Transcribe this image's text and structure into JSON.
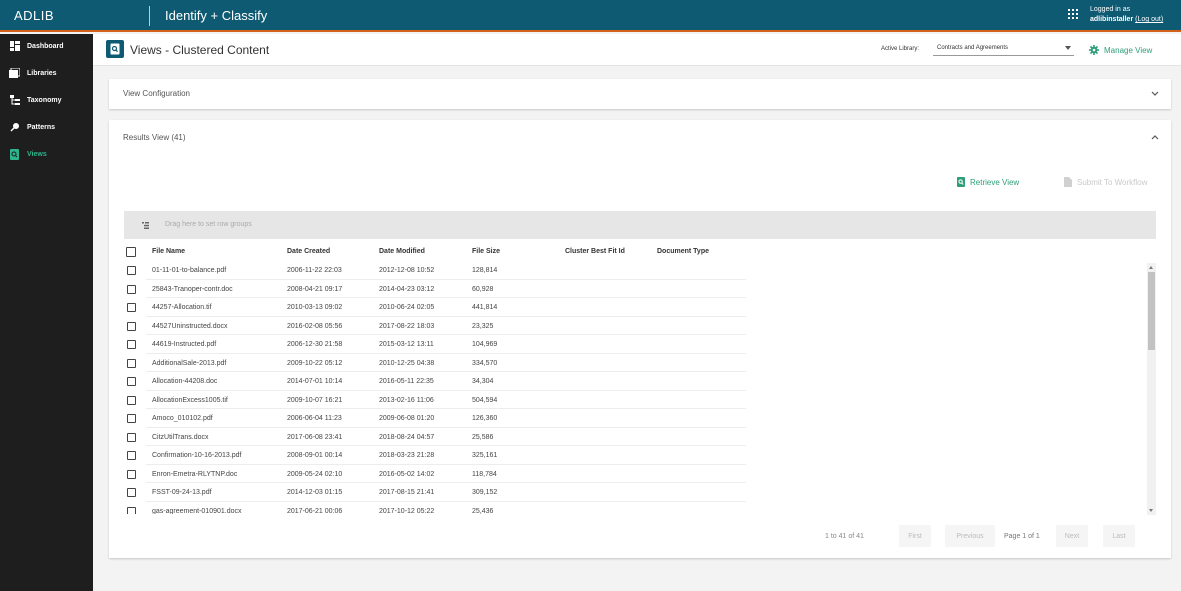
{
  "topbar": {
    "brand": "ADLIB",
    "app_title": "Identify + Classify",
    "logged_in_label": "Logged in as",
    "user": "adlibinstaller",
    "logout": "(Log out)"
  },
  "sidebar": {
    "items": [
      {
        "label": "Dashboard",
        "icon": "dashboard-icon"
      },
      {
        "label": "Libraries",
        "icon": "library-icon"
      },
      {
        "label": "Taxonomy",
        "icon": "taxonomy-icon"
      },
      {
        "label": "Patterns",
        "icon": "patterns-icon"
      },
      {
        "label": "Views",
        "icon": "views-icon",
        "active": true
      }
    ]
  },
  "header": {
    "title": "Views - Clustered Content",
    "active_library_label": "Active Library:",
    "active_library_value": "Contracts and Agreements",
    "manage_view": "Manage View"
  },
  "config_panel": {
    "title": "View Configuration"
  },
  "results": {
    "title": "Results View (41)",
    "retrieve_view": "Retrieve View",
    "submit_workflow": "Submit To Workflow",
    "group_placeholder": "Drag here to set row groups",
    "columns": [
      "File Name",
      "Date Created",
      "Date Modified",
      "File Size",
      "Cluster Best Fit Id",
      "Document Type"
    ],
    "rows": [
      [
        "01-11-01-to-balance.pdf",
        "2006-11-22 22:03",
        "2012-12-08 10:52",
        "128,814"
      ],
      [
        "25843-Tranoper-contr.doc",
        "2008-04-21 09:17",
        "2014-04-23 03:12",
        "60,928"
      ],
      [
        "44257-Allocation.tif",
        "2010-03-13 09:02",
        "2010-06-24 02:05",
        "441,814"
      ],
      [
        "44527Uninstructed.docx",
        "2016-02-08 05:56",
        "2017-08-22 18:03",
        "23,325"
      ],
      [
        "44619-Instructed.pdf",
        "2006-12-30 21:58",
        "2015-03-12 13:11",
        "104,969"
      ],
      [
        "AdditionalSale-2013.pdf",
        "2009-10-22 05:12",
        "2010-12-25 04:38",
        "334,570"
      ],
      [
        "Allocation-44208.doc",
        "2014-07-01 10:14",
        "2016-05-11 22:35",
        "34,304"
      ],
      [
        "AllocationExcess1005.tif",
        "2009-10-07 16:21",
        "2013-02-16 11:06",
        "504,594"
      ],
      [
        "Amoco_010102.pdf",
        "2006-06-04 11:23",
        "2009-06-08 01:20",
        "126,360"
      ],
      [
        "CitzUtilTrans.docx",
        "2017-06-08 23:41",
        "2018-08-24 04:57",
        "25,586"
      ],
      [
        "Confirmation-10-16-2013.pdf",
        "2008-09-01 00:14",
        "2018-03-23 21:28",
        "325,161"
      ],
      [
        "Enron-Emetra-RLYTNP.doc",
        "2009-05-24 02:10",
        "2016-05-02 14:02",
        "118,784"
      ],
      [
        "FSST-09-24-13.pdf",
        "2014-12-03 01:15",
        "2017-08-15 21:41",
        "309,152"
      ],
      [
        "gas-agreement-010901.docx",
        "2017-06-21 00:06",
        "2017-10-12 05:22",
        "25,436"
      ]
    ],
    "pager": {
      "range": "1 to 41 of 41",
      "first": "First",
      "previous": "Previous",
      "page": "Page 1 of 1",
      "next": "Next",
      "last": "Last"
    }
  },
  "colors": {
    "topbar": "#0f5a73",
    "accent_orange": "#d2611c",
    "green": "#2eb48d",
    "sidebar": "#1e1e1e"
  }
}
